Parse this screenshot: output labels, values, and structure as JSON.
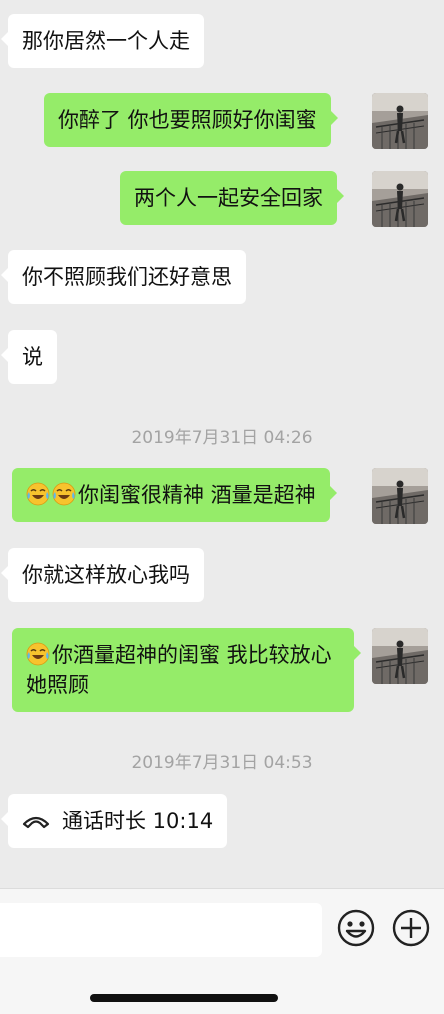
{
  "messages": [
    {
      "side": "in",
      "text": "那你居然一个人走"
    },
    {
      "side": "out",
      "text": "你醉了 你也要照顾好你闺蜜"
    },
    {
      "side": "out",
      "text": "两个人一起安全回家"
    },
    {
      "side": "in",
      "text": "你不照顾我们还好意思"
    },
    {
      "side": "in",
      "text": "说"
    },
    {
      "timestamp": "2019年7月31日 04:26"
    },
    {
      "side": "out",
      "text": "你闺蜜很精神 酒量是超神",
      "emoji": [
        "face-with-tears-of-joy-icon",
        "face-with-tears-of-joy-icon"
      ]
    },
    {
      "side": "in",
      "text": "你就这样放心我吗"
    },
    {
      "side": "out",
      "text": "你酒量超神的闺蜜 我比较放心她照顾",
      "emoji": [
        "face-with-tears-of-joy-icon"
      ]
    },
    {
      "timestamp": "2019年7月31日 04:53"
    },
    {
      "side": "in",
      "call": "通话时长 10:14",
      "icon": "phone-hangup-icon"
    }
  ],
  "input_bar": {
    "placeholder": "",
    "icons": [
      "emoji-smile-icon",
      "plus-circle-icon"
    ]
  },
  "colors": {
    "background": "#ebebeb",
    "incoming_bubble": "#ffffff",
    "outgoing_bubble": "#95ec69",
    "timestamp_text": "#a3a3a3"
  }
}
